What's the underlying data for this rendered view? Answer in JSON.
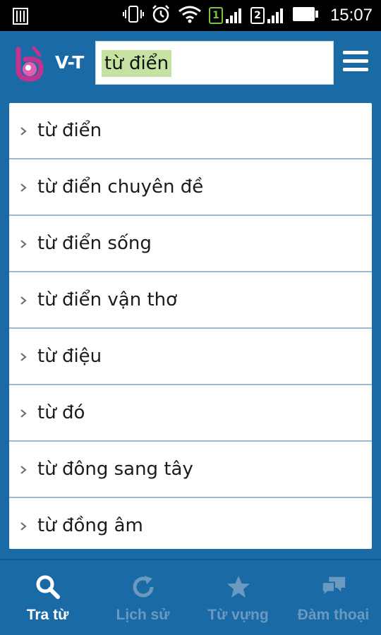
{
  "status_bar": {
    "time": "15:07",
    "sim1": "1",
    "sim2": "2",
    "icons": [
      "vibrate-icon",
      "alarm-icon",
      "wifi-icon",
      "signal-icon",
      "battery-icon"
    ]
  },
  "header": {
    "language_pair": "V-T",
    "search_value": "từ điển",
    "menu_icon": "hamburger-menu-icon",
    "logo_icon": "app-logo-icon"
  },
  "results": [
    {
      "label": "từ điển"
    },
    {
      "label": "từ điển chuyên đề"
    },
    {
      "label": "từ điển sống"
    },
    {
      "label": "từ điển vận thơ"
    },
    {
      "label": "từ điệu"
    },
    {
      "label": "từ đó"
    },
    {
      "label": "từ đông sang tây"
    },
    {
      "label": "từ đồng âm"
    }
  ],
  "bottom_nav": {
    "items": [
      {
        "label": "Tra từ",
        "icon": "search-icon",
        "active": true
      },
      {
        "label": "Lịch sử",
        "icon": "history-icon",
        "active": false
      },
      {
        "label": "Từ vựng",
        "icon": "star-icon",
        "active": false
      },
      {
        "label": "Đàm thoại",
        "icon": "chat-bubbles-icon",
        "active": false
      }
    ]
  },
  "colors": {
    "primary_blue": "#1a6aa6",
    "search_highlight": "#c5e2a3",
    "nav_inactive": "#6b9ac0",
    "logo_pink": "#c2338f"
  }
}
